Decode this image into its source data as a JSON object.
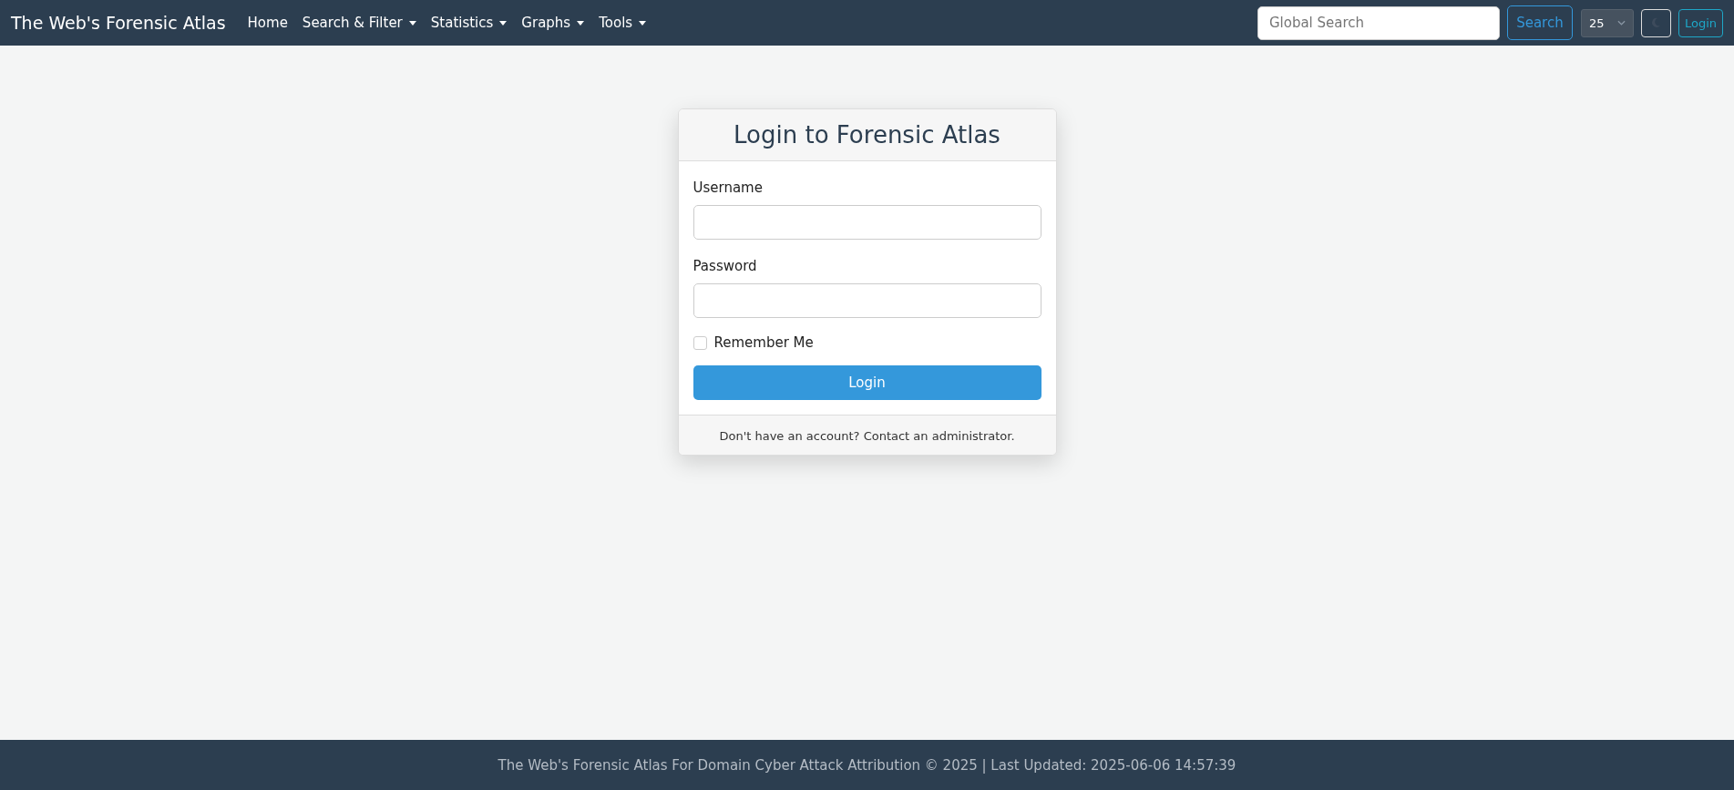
{
  "navbar": {
    "brand": "The Web's Forensic Atlas",
    "items": [
      {
        "label": "Home",
        "dropdown": false
      },
      {
        "label": "Search & Filter",
        "dropdown": true
      },
      {
        "label": "Statistics",
        "dropdown": true
      },
      {
        "label": "Graphs",
        "dropdown": true
      },
      {
        "label": "Tools",
        "dropdown": true
      }
    ],
    "search": {
      "placeholder": "Global Search",
      "button": "Search"
    },
    "page_size": "25",
    "login": "Login"
  },
  "card": {
    "title": "Login to Forensic Atlas",
    "fields": [
      {
        "label": "Username"
      },
      {
        "label": "Password"
      }
    ],
    "remember": {
      "label": "Remember Me",
      "checked": false
    },
    "submit": "Login",
    "footer": "Don't have an account? Contact an administrator."
  },
  "footer": "The Web's Forensic Atlas For Domain Cyber Attack Attribution © 2025 | Last Updated: 2025-06-06 14:57:39"
}
